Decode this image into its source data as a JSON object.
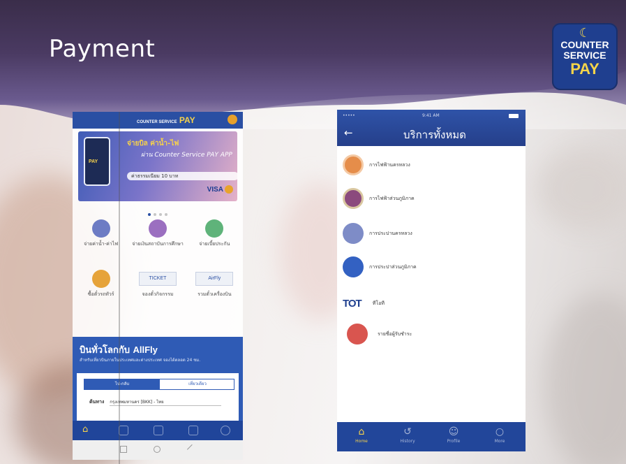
{
  "slide": {
    "title": "Payment",
    "logo": {
      "line1": "COUNTER",
      "line2": "SERVICE",
      "line3": "PAY"
    }
  },
  "app_home": {
    "header_logo": "PAY",
    "header_logo_prefix": "COUNTER SERVICE",
    "promo": {
      "headline": "จ่ายบิล ค่าน้ำ-ไฟ",
      "subline": "ผ่าน Counter Service PAY APP",
      "fee_text": "ค่าธรรมเนียม 10 บาท",
      "card_brand": "VISA",
      "phone_label": "PAY"
    },
    "grid_items": [
      {
        "label": "จ่ายค่าน้ำ-ค่าไฟ",
        "icon": "water-electric-icon",
        "color": "#6d7cc4"
      },
      {
        "label": "จ่ายเงินสถาบันการศึกษา",
        "icon": "graduation-cap-icon",
        "color": "#9b6fc0"
      },
      {
        "label": "จ่ายเบี้ยประกัน",
        "icon": "insurance-icon",
        "color": "#5fb37a"
      },
      {
        "label": "ซื้อตั๋วรถทัวร์",
        "icon": "bus-icon",
        "color": "#e6a33a"
      },
      {
        "label": "จองตั๋วกิจกรรม",
        "icon": "ticket-icon",
        "tile": "TICKET"
      },
      {
        "label": "รวมตั๋วเครื่องบิน",
        "icon": "airfly-icon",
        "tile": "AirFly"
      }
    ],
    "airfly": {
      "title": "บินทั่วโลกกับ",
      "brand": "AllFly",
      "description": "สำหรับเที่ยวบินภายในประเทศและต่างประเทศ จองได้ตลอด 24 ชม.",
      "segment_oneway": "ไป-กลับ",
      "segment_roundtrip": "เที่ยวเดียว",
      "origin_label": "ต้นทาง",
      "origin_value": "กรุงเทพมหานคร [BKK] - ไทย"
    }
  },
  "app_services": {
    "status_time": "9:41 AM",
    "status_carrier": "•••••",
    "title": "บริการทั้งหมด",
    "back_glyph": "←",
    "services": [
      {
        "label": "การไฟฟ้านครหลวง",
        "icon": "mea-icon",
        "color": "#e58d4a"
      },
      {
        "label": "การไฟฟ้าส่วนภูมิภาค",
        "icon": "pea-icon",
        "color": "#8b4a7d"
      },
      {
        "label": "การประปานครหลวง",
        "icon": "mwa-icon",
        "color": "#7e8cc7"
      },
      {
        "label": "การประปาส่วนภูมิภาค",
        "icon": "pwa-icon",
        "color": "#3361c2"
      },
      {
        "label": "ทีโอที",
        "icon": "tot-logo",
        "brand": "TOT"
      },
      {
        "label": "รายชื่อผู้รับชำระ",
        "icon": "shop-icon",
        "color": "#d9554f"
      }
    ],
    "tabs": [
      {
        "label": "Home",
        "glyph": "⌂",
        "active": true
      },
      {
        "label": "History",
        "glyph": "↺",
        "active": false
      },
      {
        "label": "Profile",
        "glyph": "☺",
        "active": false
      },
      {
        "label": "More",
        "glyph": "○",
        "active": false
      }
    ]
  }
}
